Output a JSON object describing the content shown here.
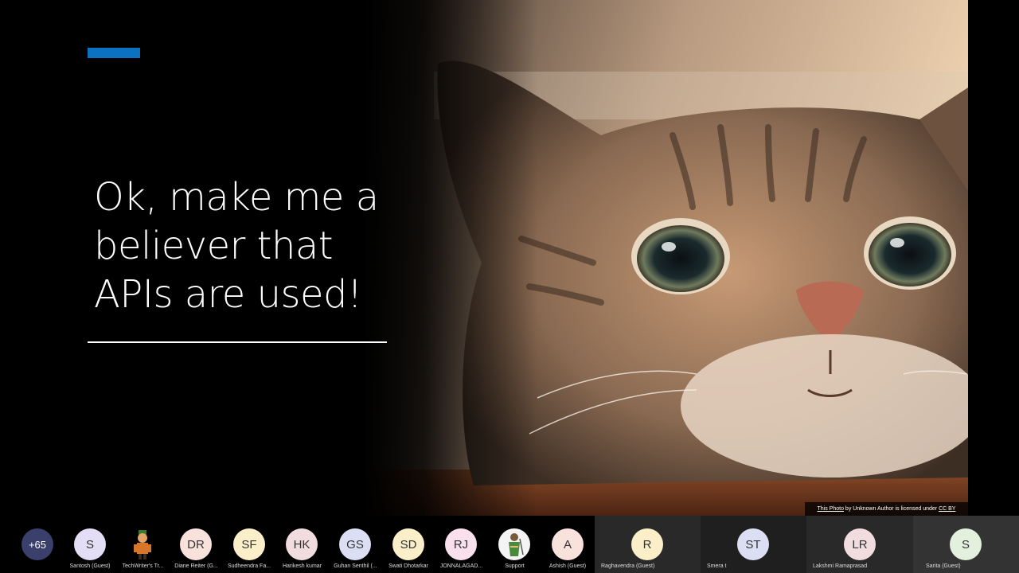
{
  "slide": {
    "title_lines": [
      "Ok, make me a",
      "believer that",
      "APIs are used!"
    ],
    "attribution": {
      "link_text": "This Photo",
      "middle_text": " by Unknown Author is licensed under ",
      "license_text": "CC BY"
    },
    "accent_color": "#0a72c0"
  },
  "participants": {
    "overflow_count": "+65",
    "gallery": [
      {
        "initials": "S",
        "name": "Santosh (Guest)",
        "color": "#e3ddf5"
      },
      {
        "initials": "",
        "name": "TechWriter's Tr...",
        "color": "",
        "icon": "avatar-photo-icon"
      },
      {
        "initials": "DR",
        "name": "Diane Reiter (G...",
        "color": "#f9e1dc"
      },
      {
        "initials": "SF",
        "name": "Sudheendra Fa...",
        "color": "#fbefc9"
      },
      {
        "initials": "HK",
        "name": "Harikesh kumar",
        "color": "#f1dde0"
      },
      {
        "initials": "GS",
        "name": "Guhan Senthil (...",
        "color": "#dcdff4"
      },
      {
        "initials": "SD",
        "name": "Swati Dhotarkar",
        "color": "#fbefc9"
      },
      {
        "initials": "RJ",
        "name": "JONNALAGAD...",
        "color": "#f9e0ec"
      },
      {
        "initials": "",
        "name": "Support",
        "color": "#f4f4f4",
        "icon": "avatar-photo-icon"
      },
      {
        "initials": "A",
        "name": "Ashish (Guest)",
        "color": "#f9e1dc"
      }
    ],
    "video": [
      {
        "initials": "R",
        "name": "Raghavendra (Guest)",
        "color": "#fbefc9"
      },
      {
        "initials": "ST",
        "name": "Smera t",
        "color": "#dcdff4"
      },
      {
        "initials": "LR",
        "name": "Lakshmi Ramaprasad",
        "color": "#f1dde0"
      },
      {
        "initials": "S",
        "name": "Sarita (Guest)",
        "color": "#e2f0dd"
      }
    ]
  }
}
